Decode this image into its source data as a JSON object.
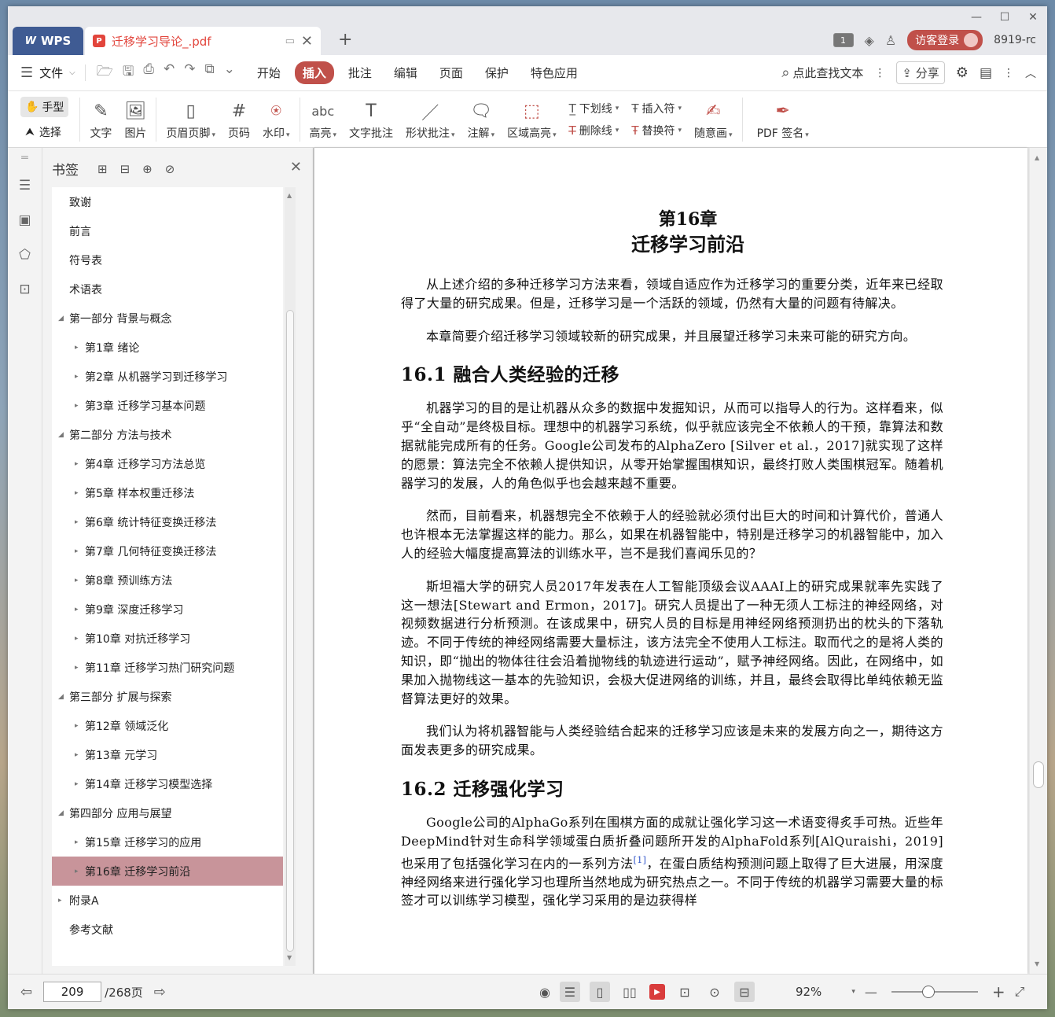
{
  "titlebar": {
    "app_tab": "WPS",
    "doc_tab": "迁移学习导论_.pdf",
    "page_badge": "1",
    "login_label": "访客登录",
    "version": "8919-rc"
  },
  "menubar": {
    "file_label": "文件",
    "items": [
      "开始",
      "插入",
      "批注",
      "编辑",
      "页面",
      "保护",
      "特色应用"
    ],
    "active": "插入",
    "search_label": "点此查找文本",
    "share_label": "分享"
  },
  "toolbar": {
    "hand_label": "手型",
    "select_label": "选择",
    "tools": [
      {
        "label": "文字",
        "icon": "text-pen-icon"
      },
      {
        "label": "图片",
        "icon": "image-icon"
      },
      {
        "label": "页眉页脚",
        "icon": "header-footer-icon"
      },
      {
        "label": "页码",
        "icon": "page-number-icon"
      },
      {
        "label": "水印",
        "icon": "watermark-icon"
      },
      {
        "label": "高亮",
        "icon": "highlight-icon"
      },
      {
        "label": "文字批注",
        "icon": "text-comment-icon"
      },
      {
        "label": "形状批注",
        "icon": "shape-comment-icon"
      },
      {
        "label": "注解",
        "icon": "note-icon"
      },
      {
        "label": "区域高亮",
        "icon": "area-highlight-icon"
      }
    ],
    "underline_label": "下划线",
    "strike_label": "删除线",
    "insert_mark_label": "插入符",
    "replace_mark_label": "替换符",
    "freehand_label": "随意画",
    "sign_label": "PDF 签名"
  },
  "bookmarks": {
    "title": "书签",
    "items": [
      {
        "label": "致谢",
        "level": 0,
        "caret": ""
      },
      {
        "label": "前言",
        "level": 0,
        "caret": ""
      },
      {
        "label": "符号表",
        "level": 0,
        "caret": ""
      },
      {
        "label": "术语表",
        "level": 0,
        "caret": ""
      },
      {
        "label": "第一部分  背景与概念",
        "level": 0,
        "caret": "◢"
      },
      {
        "label": "第1章  绪论",
        "level": 1,
        "caret": "▸"
      },
      {
        "label": "第2章  从机器学习到迁移学习",
        "level": 1,
        "caret": "▸"
      },
      {
        "label": "第3章  迁移学习基本问题",
        "level": 1,
        "caret": "▸"
      },
      {
        "label": "第二部分  方法与技术",
        "level": 0,
        "caret": "◢"
      },
      {
        "label": "第4章  迁移学习方法总览",
        "level": 1,
        "caret": "▸"
      },
      {
        "label": "第5章  样本权重迁移法",
        "level": 1,
        "caret": "▸"
      },
      {
        "label": "第6章  统计特征变换迁移法",
        "level": 1,
        "caret": "▸"
      },
      {
        "label": "第7章  几何特征变换迁移法",
        "level": 1,
        "caret": "▸"
      },
      {
        "label": "第8章  预训练方法",
        "level": 1,
        "caret": "▸"
      },
      {
        "label": "第9章  深度迁移学习",
        "level": 1,
        "caret": "▸"
      },
      {
        "label": "第10章  对抗迁移学习",
        "level": 1,
        "caret": "▸"
      },
      {
        "label": "第11章  迁移学习热门研究问题",
        "level": 1,
        "caret": "▸"
      },
      {
        "label": "第三部分  扩展与探索",
        "level": 0,
        "caret": "◢"
      },
      {
        "label": "第12章  领域泛化",
        "level": 1,
        "caret": "▸"
      },
      {
        "label": "第13章  元学习",
        "level": 1,
        "caret": "▸"
      },
      {
        "label": "第14章  迁移学习模型选择",
        "level": 1,
        "caret": "▸"
      },
      {
        "label": "第四部分  应用与展望",
        "level": 0,
        "caret": "◢"
      },
      {
        "label": "第15章  迁移学习的应用",
        "level": 1,
        "caret": "▸"
      },
      {
        "label": "第16章  迁移学习前沿",
        "level": 1,
        "caret": "▸",
        "selected": true
      },
      {
        "label": "附录A",
        "level": 0,
        "caret": "▸"
      },
      {
        "label": "参考文献",
        "level": 0,
        "caret": ""
      }
    ]
  },
  "document": {
    "chapter_number": "第16章",
    "chapter_title": "迁移学习前沿",
    "p1": "从上述介绍的多种迁移学习方法来看，领域自适应作为迁移学习的重要分类，近年来已经取得了大量的研究成果。但是，迁移学习是一个活跃的领域，仍然有大量的问题有待解决。",
    "p2": "本章简要介绍迁移学习领域较新的研究成果，并且展望迁移学习未来可能的研究方向。",
    "s1": "16.1  融合人类经验的迁移",
    "p3": "机器学习的目的是让机器从众多的数据中发掘知识，从而可以指导人的行为。这样看来，似乎“全自动”是终极目标。理想中的机器学习系统，似乎就应该完全不依赖人的干预，靠算法和数据就能完成所有的任务。Google公司发布的AlphaZero [Silver et al.，2017]就实现了这样的愿景：算法完全不依赖人提供知识，从零开始掌握围棋知识，最终打败人类围棋冠军。随着机器学习的发展，人的角色似乎也会越来越不重要。",
    "p4": "然而，目前看来，机器想完全不依赖于人的经验就必须付出巨大的时间和计算代价，普通人也许根本无法掌握这样的能力。那么，如果在机器智能中，特别是迁移学习的机器智能中，加入人的经验大幅度提高算法的训练水平，岂不是我们喜闻乐见的？",
    "p5": "斯坦福大学的研究人员2017年发表在人工智能顶级会议AAAI上的研究成果就率先实践了这一想法[Stewart and Ermon，2017]。研究人员提出了一种无须人工标注的神经网络，对视频数据进行分析预测。在该成果中，研究人员的目标是用神经网络预测扔出的枕头的下落轨迹。不同于传统的神经网络需要大量标注，该方法完全不使用人工标注。取而代之的是将人类的知识，即“抛出的物体往往会沿着抛物线的轨迹进行运动”，赋予神经网络。因此，在网络中，如果加入抛物线这一基本的先验知识，会极大促进网络的训练，并且，最终会取得比单纯依赖无监督算法更好的效果。",
    "p6": "我们认为将机器智能与人类经验结合起来的迁移学习应该是未来的发展方向之一，期待这方面发表更多的研究成果。",
    "s2": "16.2  迁移强化学习",
    "p7a": "Google公司的AlphaGo系列在围棋方面的成就让强化学习这一术语变得炙手可热。近些年DeepMind针对生命科学领域蛋白质折叠问题所开发的AlphaFold系列[AlQuraishi，2019]也采用了包括强化学习在内的一系列方法",
    "p7ref": "[1]",
    "p7b": "，在蛋白质结构预测问题上取得了巨大进展，用深度神经网络来进行强化学习也理所当然地成为研究热点之一。不同于传统的机器学习需要大量的标签才可以训练学习模型，强化学习采用的是边获得样"
  },
  "statusbar": {
    "current_page": "209",
    "total_pages": "/268页",
    "zoom": "92%",
    "zoom_fraction": 0.42
  }
}
